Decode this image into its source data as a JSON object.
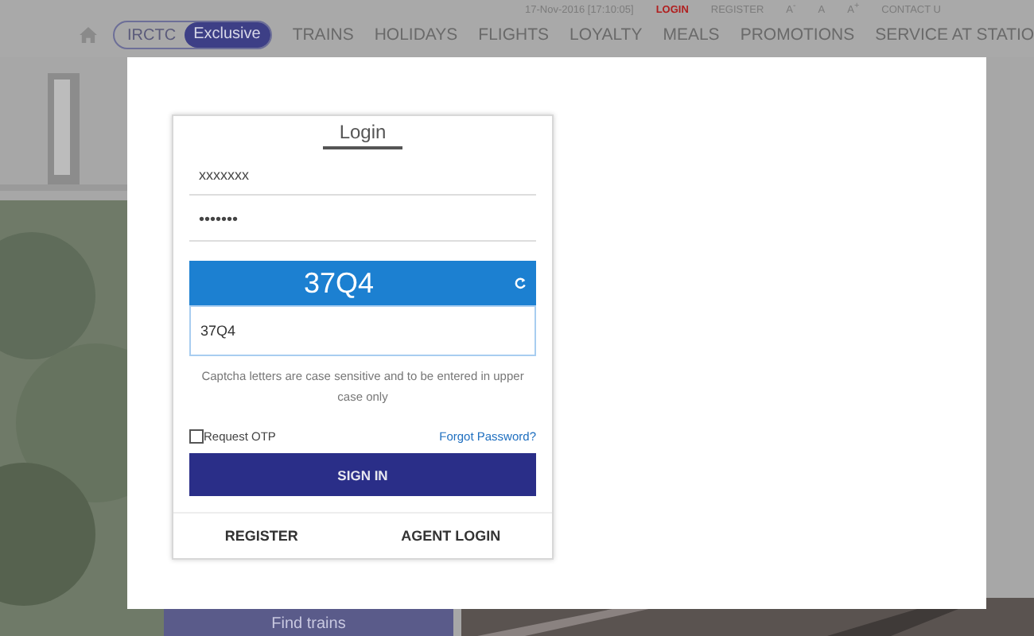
{
  "header": {
    "datetime": "17-Nov-2016 [17:10:05]",
    "top_links": [
      {
        "label": "LOGIN",
        "selected": true
      },
      {
        "label": "REGISTER",
        "selected": false
      },
      {
        "label": "A$^{-}$",
        "selected": false
      },
      {
        "label": "A",
        "selected": false
      },
      {
        "label": "A$^{+}$",
        "selected": false
      },
      {
        "label": "CONTACT U",
        "selected": false
      }
    ],
    "brand": {
      "part_1": "IRCTC",
      "part_2": "Exclusive"
    },
    "nav": [
      "TRAINS",
      "HOLIDAYS",
      "FLIGHTS",
      "LOYALTY",
      "MEALS",
      "PROMOTIONS",
      "SERVICE AT STATIO"
    ]
  },
  "login": {
    "title": "Login",
    "username": {
      "value": "xxxxxxx"
    },
    "password": {
      "value": "•••••••"
    },
    "captcha": {
      "code": "37Q4",
      "value": "37Q4",
      "hint": "Captcha letters are case sensitive and to be entered in upper case only"
    },
    "request_otp": {
      "label": "Request OTP",
      "checked": false
    },
    "forgot": "Forgot Password?",
    "sign_in": "SIGN IN",
    "footer": [
      "REGISTER",
      "AGENT LOGIN"
    ]
  },
  "find_trains": "Find trains"
}
